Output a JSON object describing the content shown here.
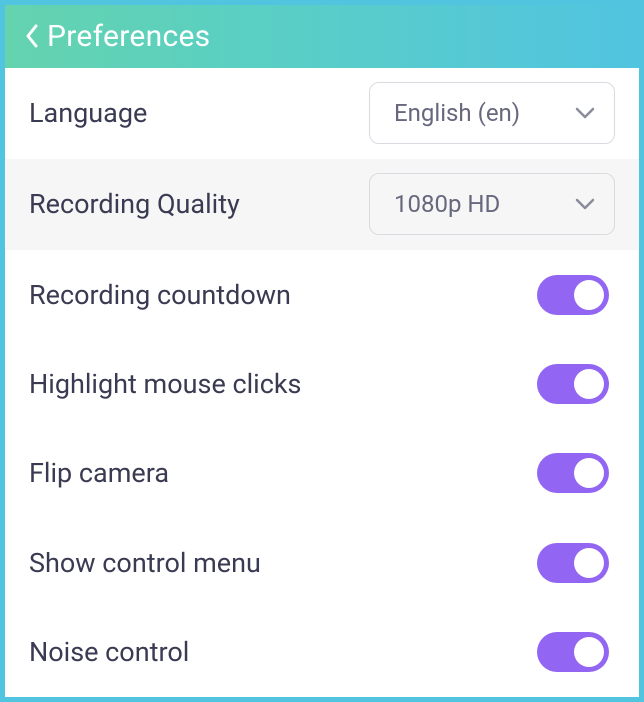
{
  "header": {
    "title": "Preferences"
  },
  "settings": {
    "language": {
      "label": "Language",
      "value": "English (en)"
    },
    "recording_quality": {
      "label": "Recording Quality",
      "value": "1080p HD"
    },
    "recording_countdown": {
      "label": "Recording countdown",
      "on": true
    },
    "highlight_mouse_clicks": {
      "label": "Highlight mouse clicks",
      "on": true
    },
    "flip_camera": {
      "label": "Flip camera",
      "on": true
    },
    "show_control_menu": {
      "label": "Show control menu",
      "on": true
    },
    "noise_control": {
      "label": "Noise control",
      "on": true
    }
  }
}
